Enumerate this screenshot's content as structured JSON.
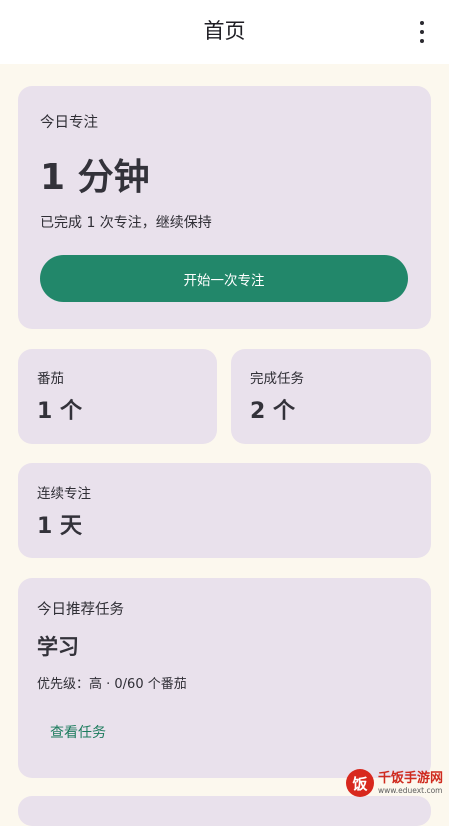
{
  "appbar": {
    "title": "首页",
    "more_icon": "more-vert-icon"
  },
  "focus_card": {
    "label": "今日专注",
    "value": "1 分钟",
    "subtitle": "已完成 1 次专注，继续保持",
    "start_button": "开始一次专注"
  },
  "stats": {
    "tomato_label": "番茄",
    "tomato_value": "1 个",
    "tasks_label": "完成任务",
    "tasks_value": "2 个",
    "streak_label": "连续专注",
    "streak_value": "1 天"
  },
  "recommended": {
    "label": "今日推荐任务",
    "task_name": "学习",
    "meta": "优先级：高 · 0/60 个番茄",
    "view_link": "查看任务"
  },
  "watermark": {
    "name": "千饭手游网",
    "url": "www.eduext.com"
  },
  "colors": {
    "accent": "#22876a",
    "card": "#e9e1ec",
    "background": "#fcf8ee"
  }
}
